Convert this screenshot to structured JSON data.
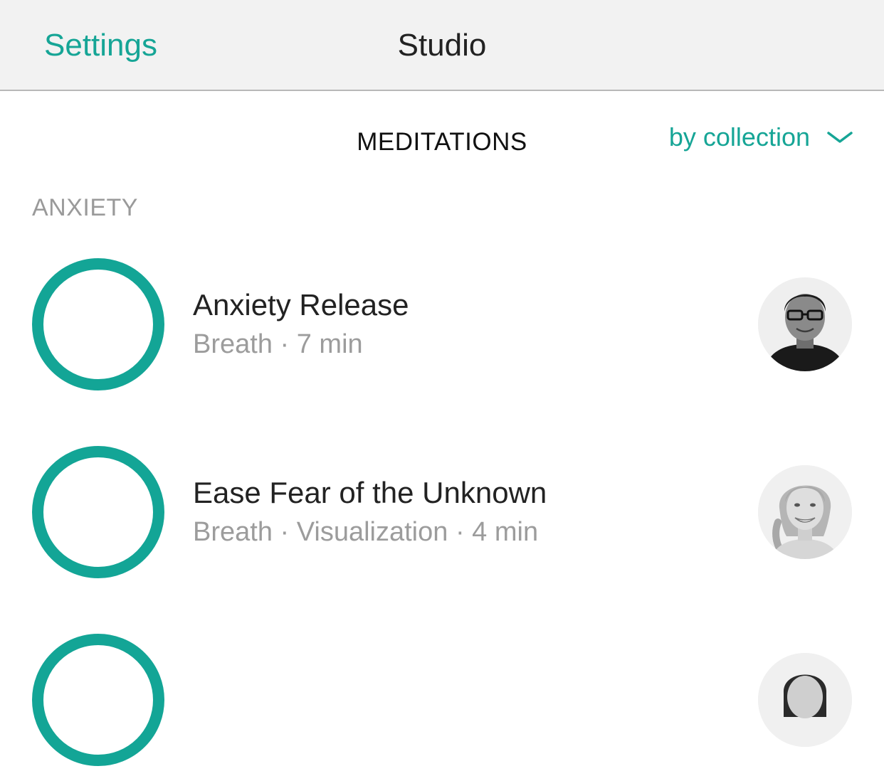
{
  "nav": {
    "back_label": "Settings",
    "title": "Studio"
  },
  "section": {
    "title": "MEDITATIONS",
    "sort_label": "by collection"
  },
  "category": {
    "name": "ANXIETY"
  },
  "meditations": [
    {
      "title": "Anxiety Release",
      "meta": "Breath · 7 min",
      "teacher_avatar": "male-teacher-avatar"
    },
    {
      "title": "Ease Fear of the Unknown",
      "meta": "Breath · Visualization · 4 min",
      "teacher_avatar": "female-teacher-avatar"
    },
    {
      "title": "",
      "meta": "",
      "teacher_avatar": "female-teacher-avatar"
    }
  ],
  "colors": {
    "accent": "#16a596",
    "ring": "#13a596",
    "navbar_bg": "#f2f2f2",
    "secondary_text": "#9c9c9c"
  },
  "icons": {
    "sort": "chevron-down-icon"
  }
}
